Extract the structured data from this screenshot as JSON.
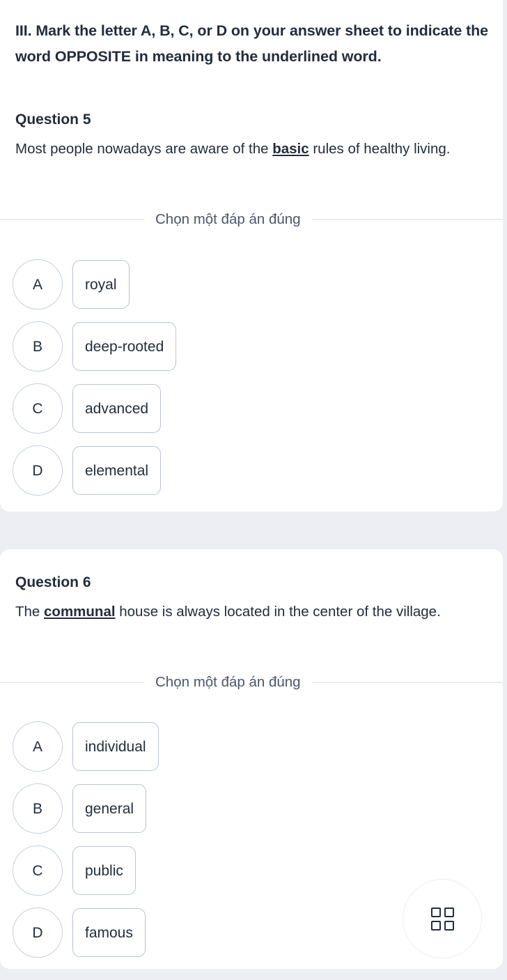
{
  "section": {
    "heading": "III. Mark the letter A, B, C, or D on your answer sheet to indicate the word OPPOSITE in meaning to the underlined word."
  },
  "divider_label": "Chọn một đáp án đúng",
  "colors": {
    "page_background": "#eceef3",
    "card_background": "#ffffff",
    "text_primary": "#222d3d",
    "text_muted": "#49566b",
    "option_letter_border": "#c7d0de",
    "option_box_border": "#b9c4d4",
    "divider_rule": "#e9ebf2",
    "fab_border": "#edeff5"
  },
  "questions": [
    {
      "title": "Question 5",
      "sentence_before": "Most people nowadays are aware of the ",
      "sentence_underlined": "basic",
      "sentence_after": " rules of healthy living.",
      "prompt": "Chọn một đáp án đúng",
      "options": [
        {
          "letter": "A",
          "text": "royal"
        },
        {
          "letter": "B",
          "text": "deep-rooted"
        },
        {
          "letter": "C",
          "text": "advanced"
        },
        {
          "letter": "D",
          "text": "elemental"
        }
      ]
    },
    {
      "title": "Question 6",
      "sentence_before": "The ",
      "sentence_underlined": "communal",
      "sentence_after": " house is always located in the center of the village.",
      "prompt": "Chọn một đáp án đúng",
      "options": [
        {
          "letter": "A",
          "text": "individual"
        },
        {
          "letter": "B",
          "text": "general"
        },
        {
          "letter": "C",
          "text": "public"
        },
        {
          "letter": "D",
          "text": "famous"
        }
      ]
    }
  ],
  "fab": {
    "icon": "grid-2x2-icon"
  }
}
